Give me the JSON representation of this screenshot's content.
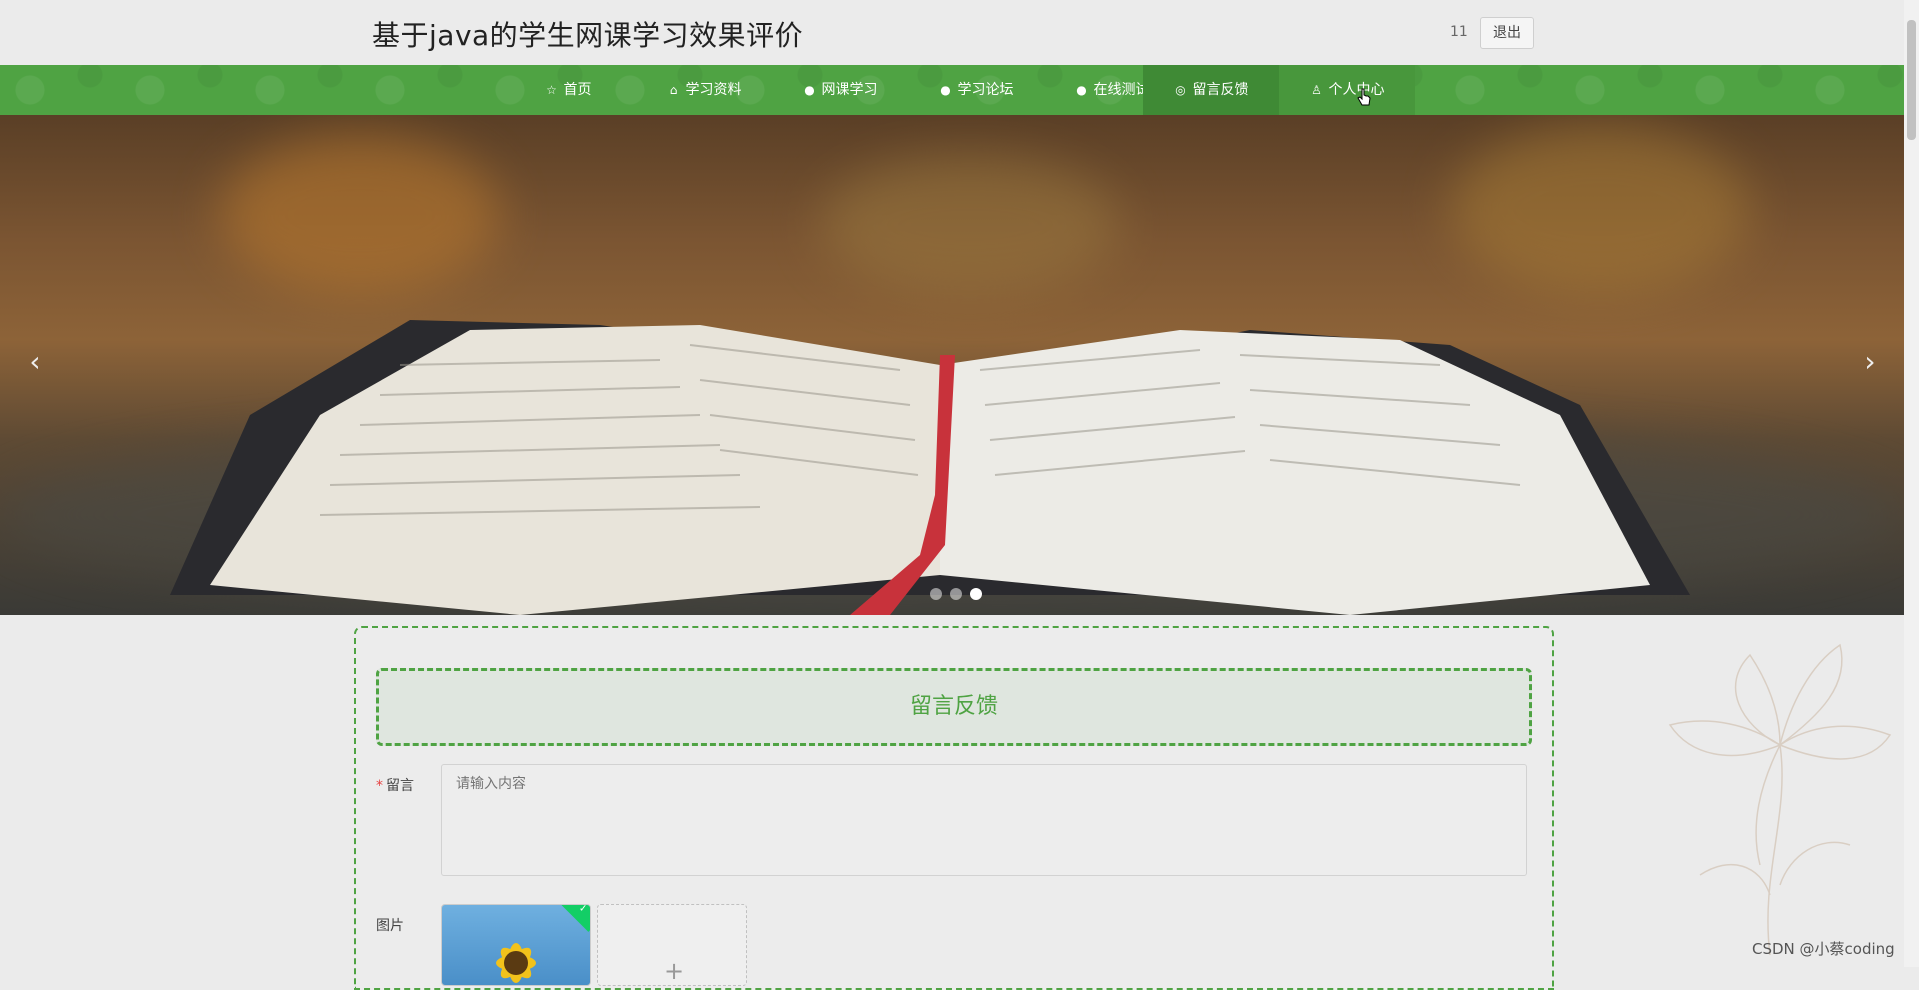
{
  "header": {
    "title": "基于java的学生网课学习效果评价",
    "username": "11",
    "logout_label": "退出"
  },
  "nav": {
    "items": [
      {
        "label": "首页",
        "icon": "star-icon"
      },
      {
        "label": "学习资料",
        "icon": "bag-icon"
      },
      {
        "label": "网课学习",
        "icon": "info-icon"
      },
      {
        "label": "学习论坛",
        "icon": "question-icon"
      },
      {
        "label": "在线测试",
        "icon": "info-icon"
      },
      {
        "label": "留言反馈",
        "icon": "globe-icon"
      },
      {
        "label": "个人中心",
        "icon": "user-icon"
      }
    ],
    "active_index": 5,
    "accent": "#4fa343"
  },
  "carousel": {
    "slide_count": 3,
    "active_slide": 3,
    "prev_arrow": "‹",
    "next_arrow": "›"
  },
  "form": {
    "title": "留言反馈",
    "message_label": "留言",
    "message_placeholder": "请输入内容",
    "image_label": "图片",
    "upload_plus": "+"
  },
  "watermark": "CSDN @小蔡coding"
}
